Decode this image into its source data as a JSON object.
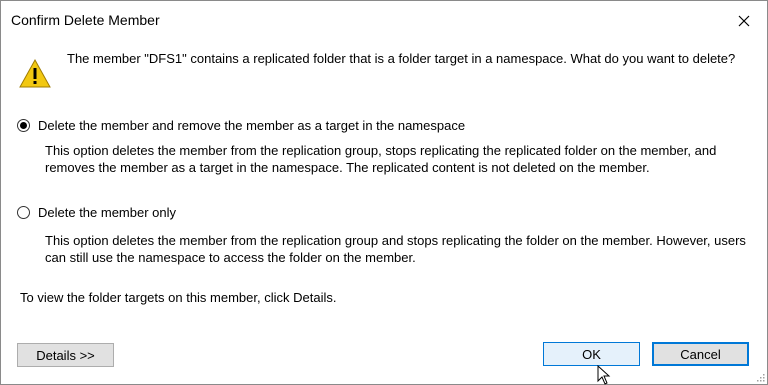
{
  "dialog": {
    "title": "Confirm Delete Member",
    "message": "The member \"DFS1\" contains a replicated folder that is a folder target in a namespace. What do you want to delete?"
  },
  "options": [
    {
      "label": "Delete the member and remove the member as a target in the namespace",
      "description": "This option deletes the member from the replication group, stops replicating the replicated folder on the member, and removes the member as a target in the namespace. The replicated content is not deleted on the member.",
      "selected": true
    },
    {
      "label": "Delete the member only",
      "description": "This option deletes the member from the replication group and stops replicating the folder on the member. However, users can still use the namespace to access the folder on the member.",
      "selected": false
    }
  ],
  "footer_text": "To view the folder targets on this member, click Details.",
  "buttons": {
    "details": "Details >>",
    "ok": "OK",
    "cancel": "Cancel"
  },
  "icons": {
    "close": "close-icon",
    "warning": "warning-icon",
    "cursor": "mouse-cursor-icon"
  },
  "colors": {
    "accent": "#0078d7",
    "warning_fill": "#f2c811"
  }
}
